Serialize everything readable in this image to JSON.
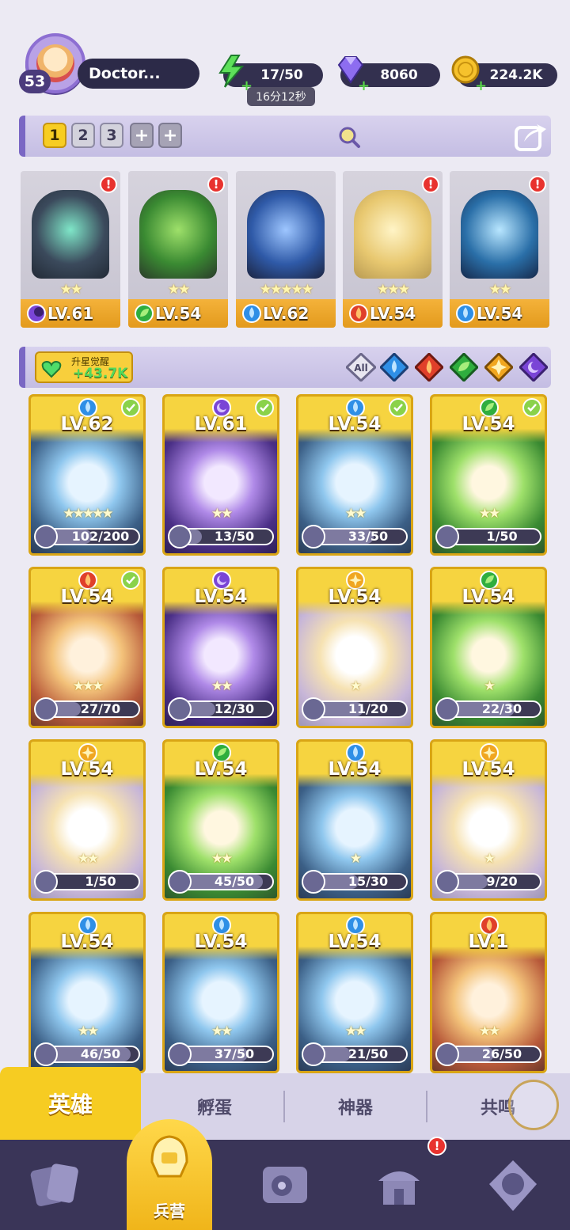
{
  "player": {
    "level": "53",
    "name": "Doctor..."
  },
  "resources": {
    "energy": "17/50",
    "energy_timer": "16分12秒",
    "gems": "8060",
    "gold": "224.2K"
  },
  "teams": {
    "tabs": [
      "1",
      "2",
      "3",
      "+",
      "+"
    ],
    "active": "1"
  },
  "team_slots": [
    {
      "level": "LV.61",
      "stars": "★★",
      "element": "dark",
      "alert": "!"
    },
    {
      "level": "LV.54",
      "stars": "★★",
      "element": "nature",
      "alert": "!"
    },
    {
      "level": "LV.62",
      "stars": "★★★★★",
      "element": "water",
      "alert": ""
    },
    {
      "level": "LV.54",
      "stars": "★★★",
      "element": "fire",
      "alert": "!"
    },
    {
      "level": "LV.54",
      "stars": "★★",
      "element": "water",
      "alert": "!"
    }
  ],
  "awaken": {
    "label": "升星觉醒",
    "value": "+43.7K"
  },
  "filters": [
    "All",
    "water",
    "fire",
    "nature",
    "light",
    "dark"
  ],
  "heroes": [
    {
      "level": "LV.62",
      "element": "water",
      "checked": true,
      "stars": "★★★★★",
      "progress": "102/200",
      "frac": 0.51
    },
    {
      "level": "LV.61",
      "element": "dark",
      "checked": true,
      "stars": "★★",
      "progress": "13/50",
      "frac": 0.26
    },
    {
      "level": "LV.54",
      "element": "water",
      "checked": true,
      "stars": "★★",
      "progress": "33/50",
      "frac": 0.66
    },
    {
      "level": "LV.54",
      "element": "nature",
      "checked": true,
      "stars": "★★",
      "progress": "1/50",
      "frac": 0.02
    },
    {
      "level": "LV.54",
      "element": "fire",
      "checked": true,
      "stars": "★★★",
      "progress": "27/70",
      "frac": 0.39
    },
    {
      "level": "LV.54",
      "element": "dark",
      "checked": false,
      "stars": "★★",
      "progress": "12/30",
      "frac": 0.4
    },
    {
      "level": "LV.54",
      "element": "light",
      "checked": false,
      "stars": "★",
      "progress": "11/20",
      "frac": 0.55
    },
    {
      "level": "LV.54",
      "element": "nature",
      "checked": false,
      "stars": "★",
      "progress": "22/30",
      "frac": 0.73
    },
    {
      "level": "LV.54",
      "element": "light",
      "checked": false,
      "stars": "★★",
      "progress": "1/50",
      "frac": 0.02
    },
    {
      "level": "LV.54",
      "element": "nature",
      "checked": false,
      "stars": "★★",
      "progress": "45/50",
      "frac": 0.9
    },
    {
      "level": "LV.54",
      "element": "water",
      "checked": false,
      "stars": "★",
      "progress": "15/30",
      "frac": 0.5
    },
    {
      "level": "LV.54",
      "element": "light",
      "checked": false,
      "stars": "★",
      "progress": "9/20",
      "frac": 0.45
    },
    {
      "level": "LV.54",
      "element": "water",
      "checked": false,
      "stars": "★★",
      "progress": "46/50",
      "frac": 0.92
    },
    {
      "level": "LV.54",
      "element": "water",
      "checked": false,
      "stars": "★★",
      "progress": "37/50",
      "frac": 0.74
    },
    {
      "level": "LV.54",
      "element": "water",
      "checked": false,
      "stars": "★★",
      "progress": "21/50",
      "frac": 0.42
    },
    {
      "level": "LV.1",
      "element": "fire",
      "checked": false,
      "stars": "★★",
      "progress": "26/50",
      "frac": 0.52
    }
  ],
  "subtabs": [
    "英雄",
    "孵蛋",
    "神器",
    "共鸣"
  ],
  "nav": {
    "active_label": "兵营",
    "alert": "!"
  },
  "colors": {
    "water": "#2f8fe6",
    "fire": "#e0402a",
    "nature": "#2fae3e",
    "light": "#f0a620",
    "dark": "#7a45d6"
  }
}
